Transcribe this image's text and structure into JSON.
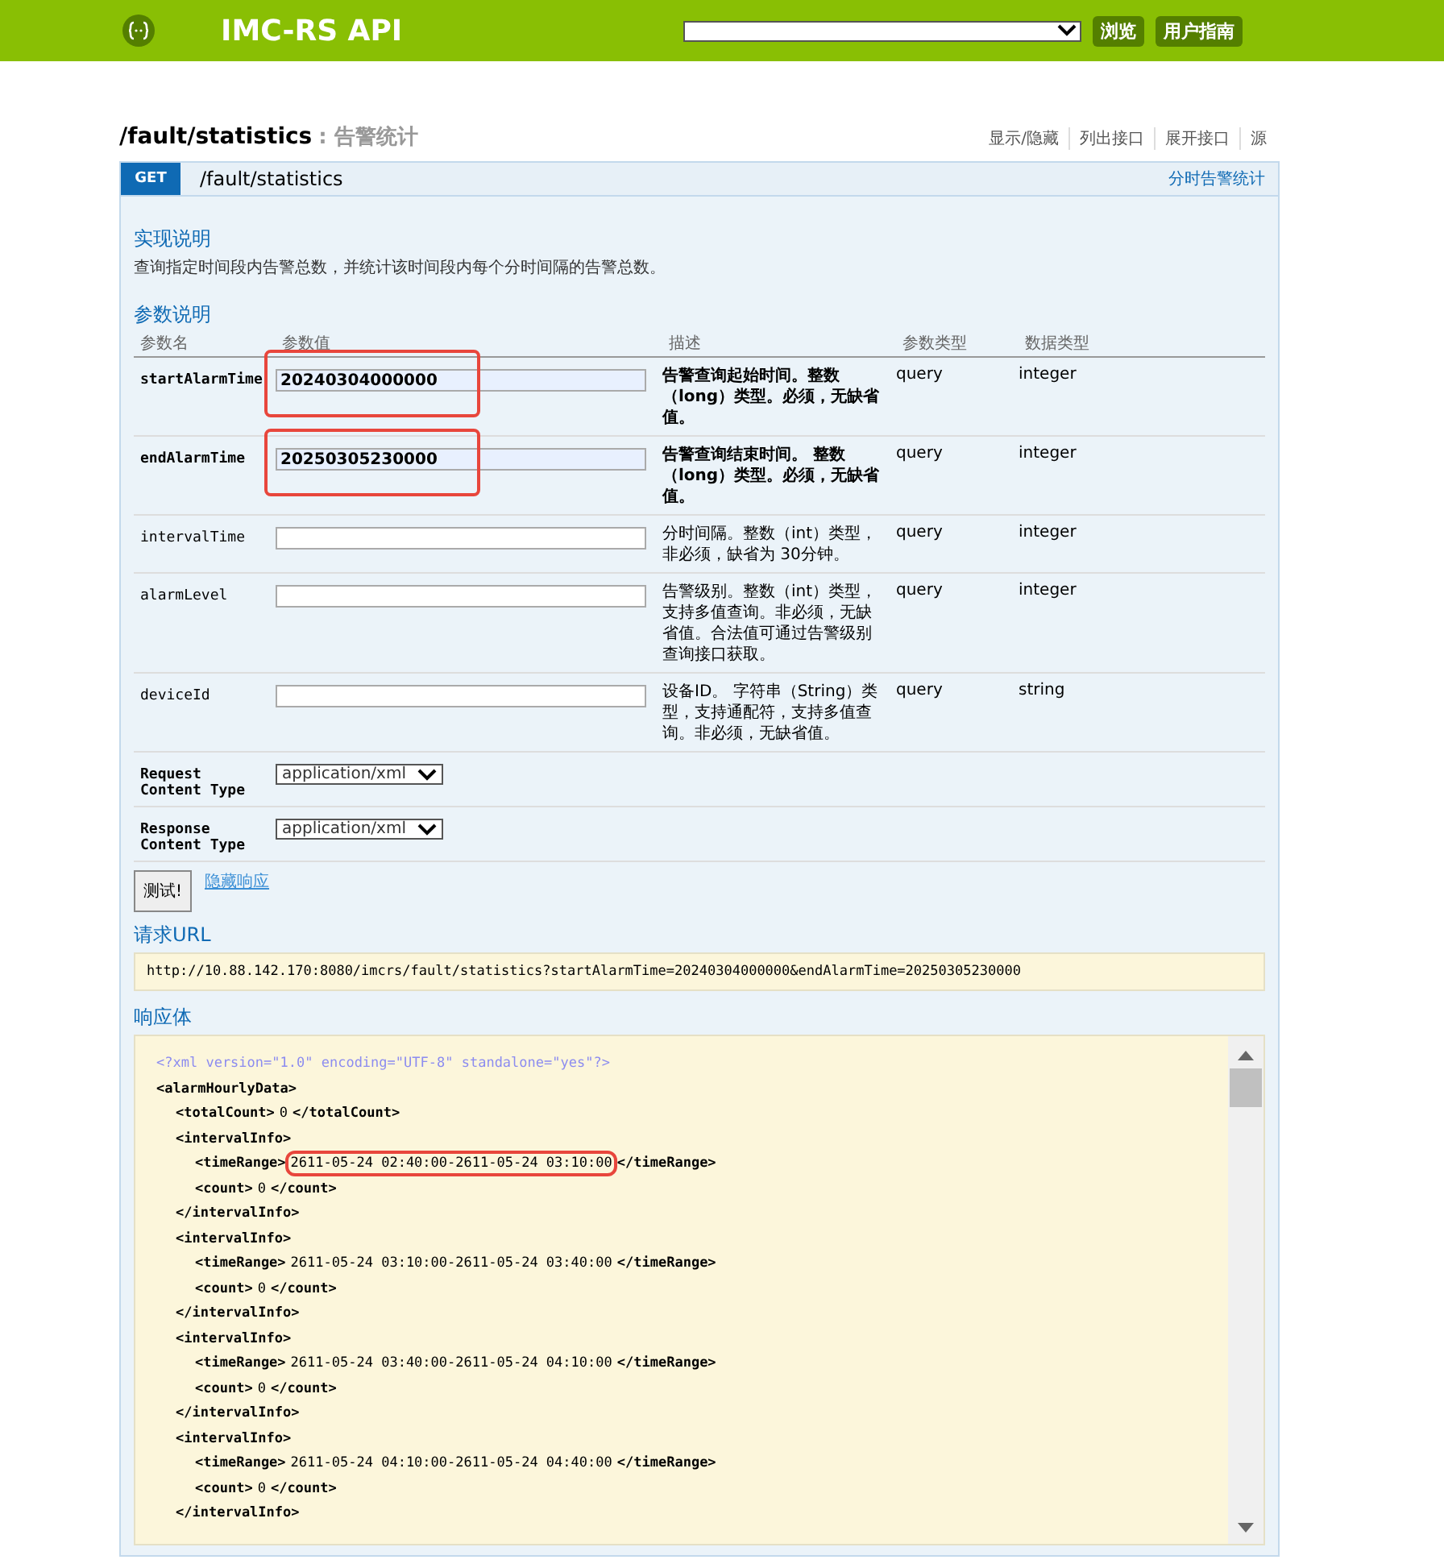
{
  "header": {
    "title": "IMC-RS API",
    "buttons": [
      "浏览",
      "用户指南"
    ]
  },
  "resource": {
    "path": "/fault/statistics",
    "separator": ":",
    "summary": "告警统计",
    "links": [
      "显示/隐藏",
      "列出接口",
      "展开接口",
      "源"
    ]
  },
  "operation": {
    "method": "GET",
    "path": "/fault/statistics",
    "summary": "分时告警统计"
  },
  "implementation": {
    "heading": "实现说明",
    "text": "查询指定时间段内告警总数，并统计该时间段内每个分时间隔的告警总数。"
  },
  "parameters": {
    "heading": "参数说明",
    "columns": [
      "参数名",
      "参数值",
      "描述",
      "参数类型",
      "数据类型"
    ],
    "rows": [
      {
        "name": "startAlarmTime",
        "value": "20240304000000",
        "description": "告警查询起始时间。整数（long）类型。必须，无缺省值。",
        "required": true,
        "highlighted": true,
        "param_type": "query",
        "data_type": "integer"
      },
      {
        "name": "endAlarmTime",
        "value": "20250305230000",
        "description": "告警查询结束时间。 整数（long）类型。必须，无缺省值。",
        "required": true,
        "highlighted": true,
        "param_type": "query",
        "data_type": "integer"
      },
      {
        "name": "intervalTime",
        "value": "",
        "description": "分时间隔。整数（int）类型，非必须，缺省为 30分钟。",
        "required": false,
        "highlighted": false,
        "param_type": "query",
        "data_type": "integer"
      },
      {
        "name": "alarmLevel",
        "value": "",
        "description": "告警级别。整数（int）类型，支持多值查询。非必须，无缺省值。合法值可通过告警级别查询接口获取。",
        "required": false,
        "highlighted": false,
        "param_type": "query",
        "data_type": "integer"
      },
      {
        "name": "deviceId",
        "value": "",
        "description": "设备ID。 字符串（String）类型，支持通配符，支持多值查询。非必须，无缺省值。",
        "required": false,
        "highlighted": false,
        "param_type": "query",
        "data_type": "string"
      }
    ],
    "content_types": [
      {
        "label": [
          "Request",
          "Content Type"
        ],
        "value": "application/xml"
      },
      {
        "label": [
          "Response",
          "Content Type"
        ],
        "value": "application/xml"
      }
    ]
  },
  "actions": {
    "button": "测试!",
    "link": "隐藏响应"
  },
  "request_url": {
    "heading": "请求URL",
    "url": "http://10.88.142.170:8080/imcrs/fault/statistics?startAlarmTime=20240304000000&endAlarmTime=20250305230000"
  },
  "response_body": {
    "heading": "响应体",
    "declaration": "<?xml version=\"1.0\" encoding=\"UTF-8\" standalone=\"yes\"?>",
    "root": {
      "kind": "element",
      "open": "<alarmHourlyData>",
      "children": [
        {
          "kind": "value",
          "open": "<totalCount>",
          "value": "0",
          "close": "</totalCount>",
          "highlighted": false
        },
        {
          "kind": "element",
          "open": "<intervalInfo>",
          "close": "</intervalInfo>",
          "children": [
            {
              "kind": "value",
              "open": "<timeRange>",
              "value": "2611-05-24 02:40:00-2611-05-24 03:10:00",
              "close": "</timeRange>",
              "highlighted": true
            },
            {
              "kind": "value",
              "open": "<count>",
              "value": "0",
              "close": "</count>",
              "highlighted": false
            }
          ]
        },
        {
          "kind": "element",
          "open": "<intervalInfo>",
          "close": "</intervalInfo>",
          "children": [
            {
              "kind": "value",
              "open": "<timeRange>",
              "value": "2611-05-24 03:10:00-2611-05-24 03:40:00",
              "close": "</timeRange>",
              "highlighted": false
            },
            {
              "kind": "value",
              "open": "<count>",
              "value": "0",
              "close": "</count>",
              "highlighted": false
            }
          ]
        },
        {
          "kind": "element",
          "open": "<intervalInfo>",
          "close": "</intervalInfo>",
          "children": [
            {
              "kind": "value",
              "open": "<timeRange>",
              "value": "2611-05-24 03:40:00-2611-05-24 04:10:00",
              "close": "</timeRange>",
              "highlighted": false
            },
            {
              "kind": "value",
              "open": "<count>",
              "value": "0",
              "close": "</count>",
              "highlighted": false
            }
          ]
        },
        {
          "kind": "element",
          "open": "<intervalInfo>",
          "close": "</intervalInfo>",
          "children": [
            {
              "kind": "value",
              "open": "<timeRange>",
              "value": "2611-05-24 04:10:00-2611-05-24 04:40:00",
              "close": "</timeRange>",
              "highlighted": false
            },
            {
              "kind": "value",
              "open": "<count>",
              "value": "0",
              "close": "</count>",
              "highlighted": false
            }
          ]
        }
      ]
    }
  }
}
